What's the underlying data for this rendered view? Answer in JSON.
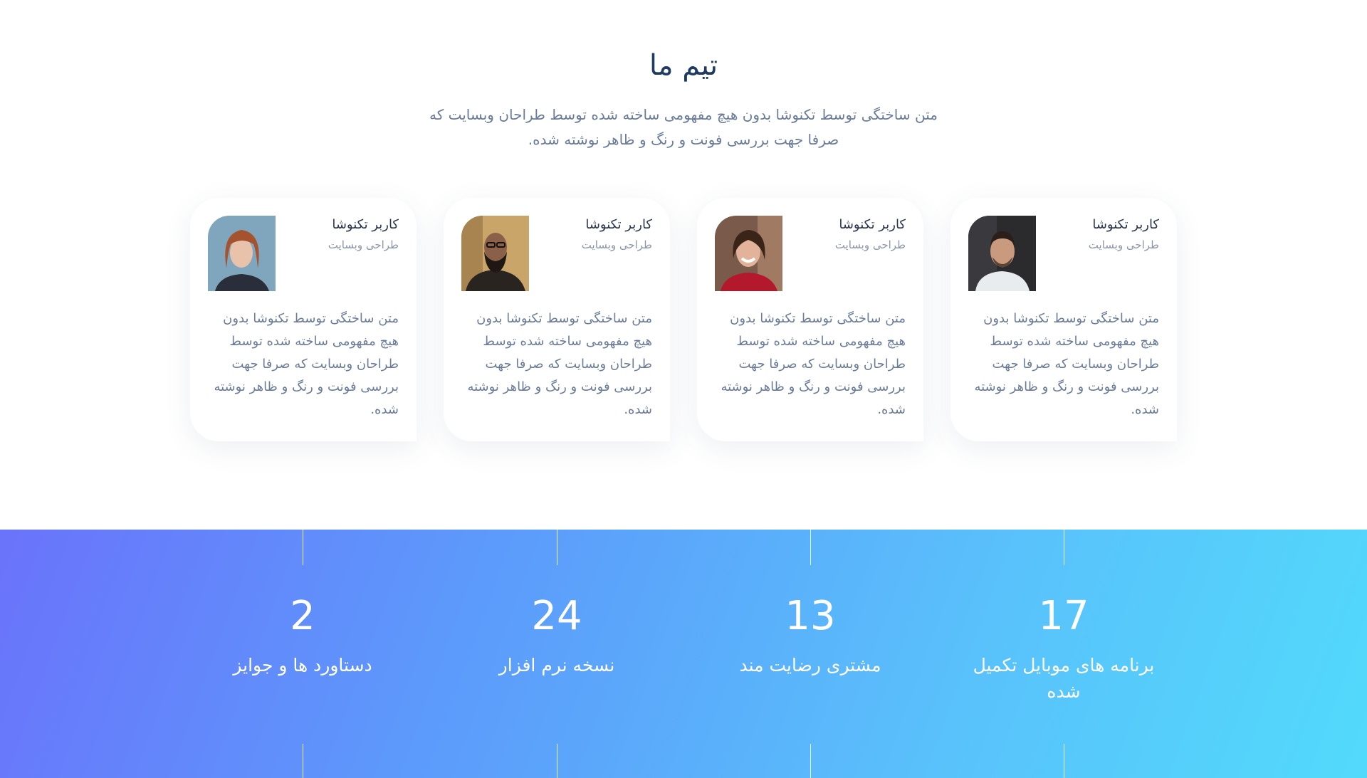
{
  "team": {
    "title": "تیم ما",
    "description": "متن ساختگی توسط تکنوشا بدون هیچ مفهومی ساخته شده توسط طراحان وبسایت که صرفا جهت بررسی فونت و رنگ و ظاهر نوشته شده.",
    "members": [
      {
        "name": "کاربر تکنوشا",
        "role": "طراحی وبسایت",
        "bio": "متن ساختگی توسط تکنوشا بدون هیچ مفهومی ساخته شده توسط طراحان وبسایت که صرفا جهت بررسی فونت و رنگ و ظاهر نوشته شده."
      },
      {
        "name": "کاربر تکنوشا",
        "role": "طراحی وبسایت",
        "bio": "متن ساختگی توسط تکنوشا بدون هیچ مفهومی ساخته شده توسط طراحان وبسایت که صرفا جهت بررسی فونت و رنگ و ظاهر نوشته شده."
      },
      {
        "name": "کاربر تکنوشا",
        "role": "طراحی وبسایت",
        "bio": "متن ساختگی توسط تکنوشا بدون هیچ مفهومی ساخته شده توسط طراحان وبسایت که صرفا جهت بررسی فونت و رنگ و ظاهر نوشته شده."
      },
      {
        "name": "کاربر تکنوشا",
        "role": "طراحی وبسایت",
        "bio": "متن ساختگی توسط تکنوشا بدون هیچ مفهومی ساخته شده توسط طراحان وبسایت که صرفا جهت بررسی فونت و رنگ و ظاهر نوشته شده."
      }
    ]
  },
  "stats": [
    {
      "number": "17",
      "label": "برنامه های موبایل تکمیل شده"
    },
    {
      "number": "13",
      "label": "مشتری رضایت مند"
    },
    {
      "number": "24",
      "label": "نسخه نرم افزار"
    },
    {
      "number": "2",
      "label": "دستاورد ها و جوایز"
    }
  ],
  "colors": {
    "gradient_start": "#6a73fb",
    "gradient_end": "#52dafb",
    "title": "#1f3a63",
    "body_text": "#6a7c9a"
  }
}
